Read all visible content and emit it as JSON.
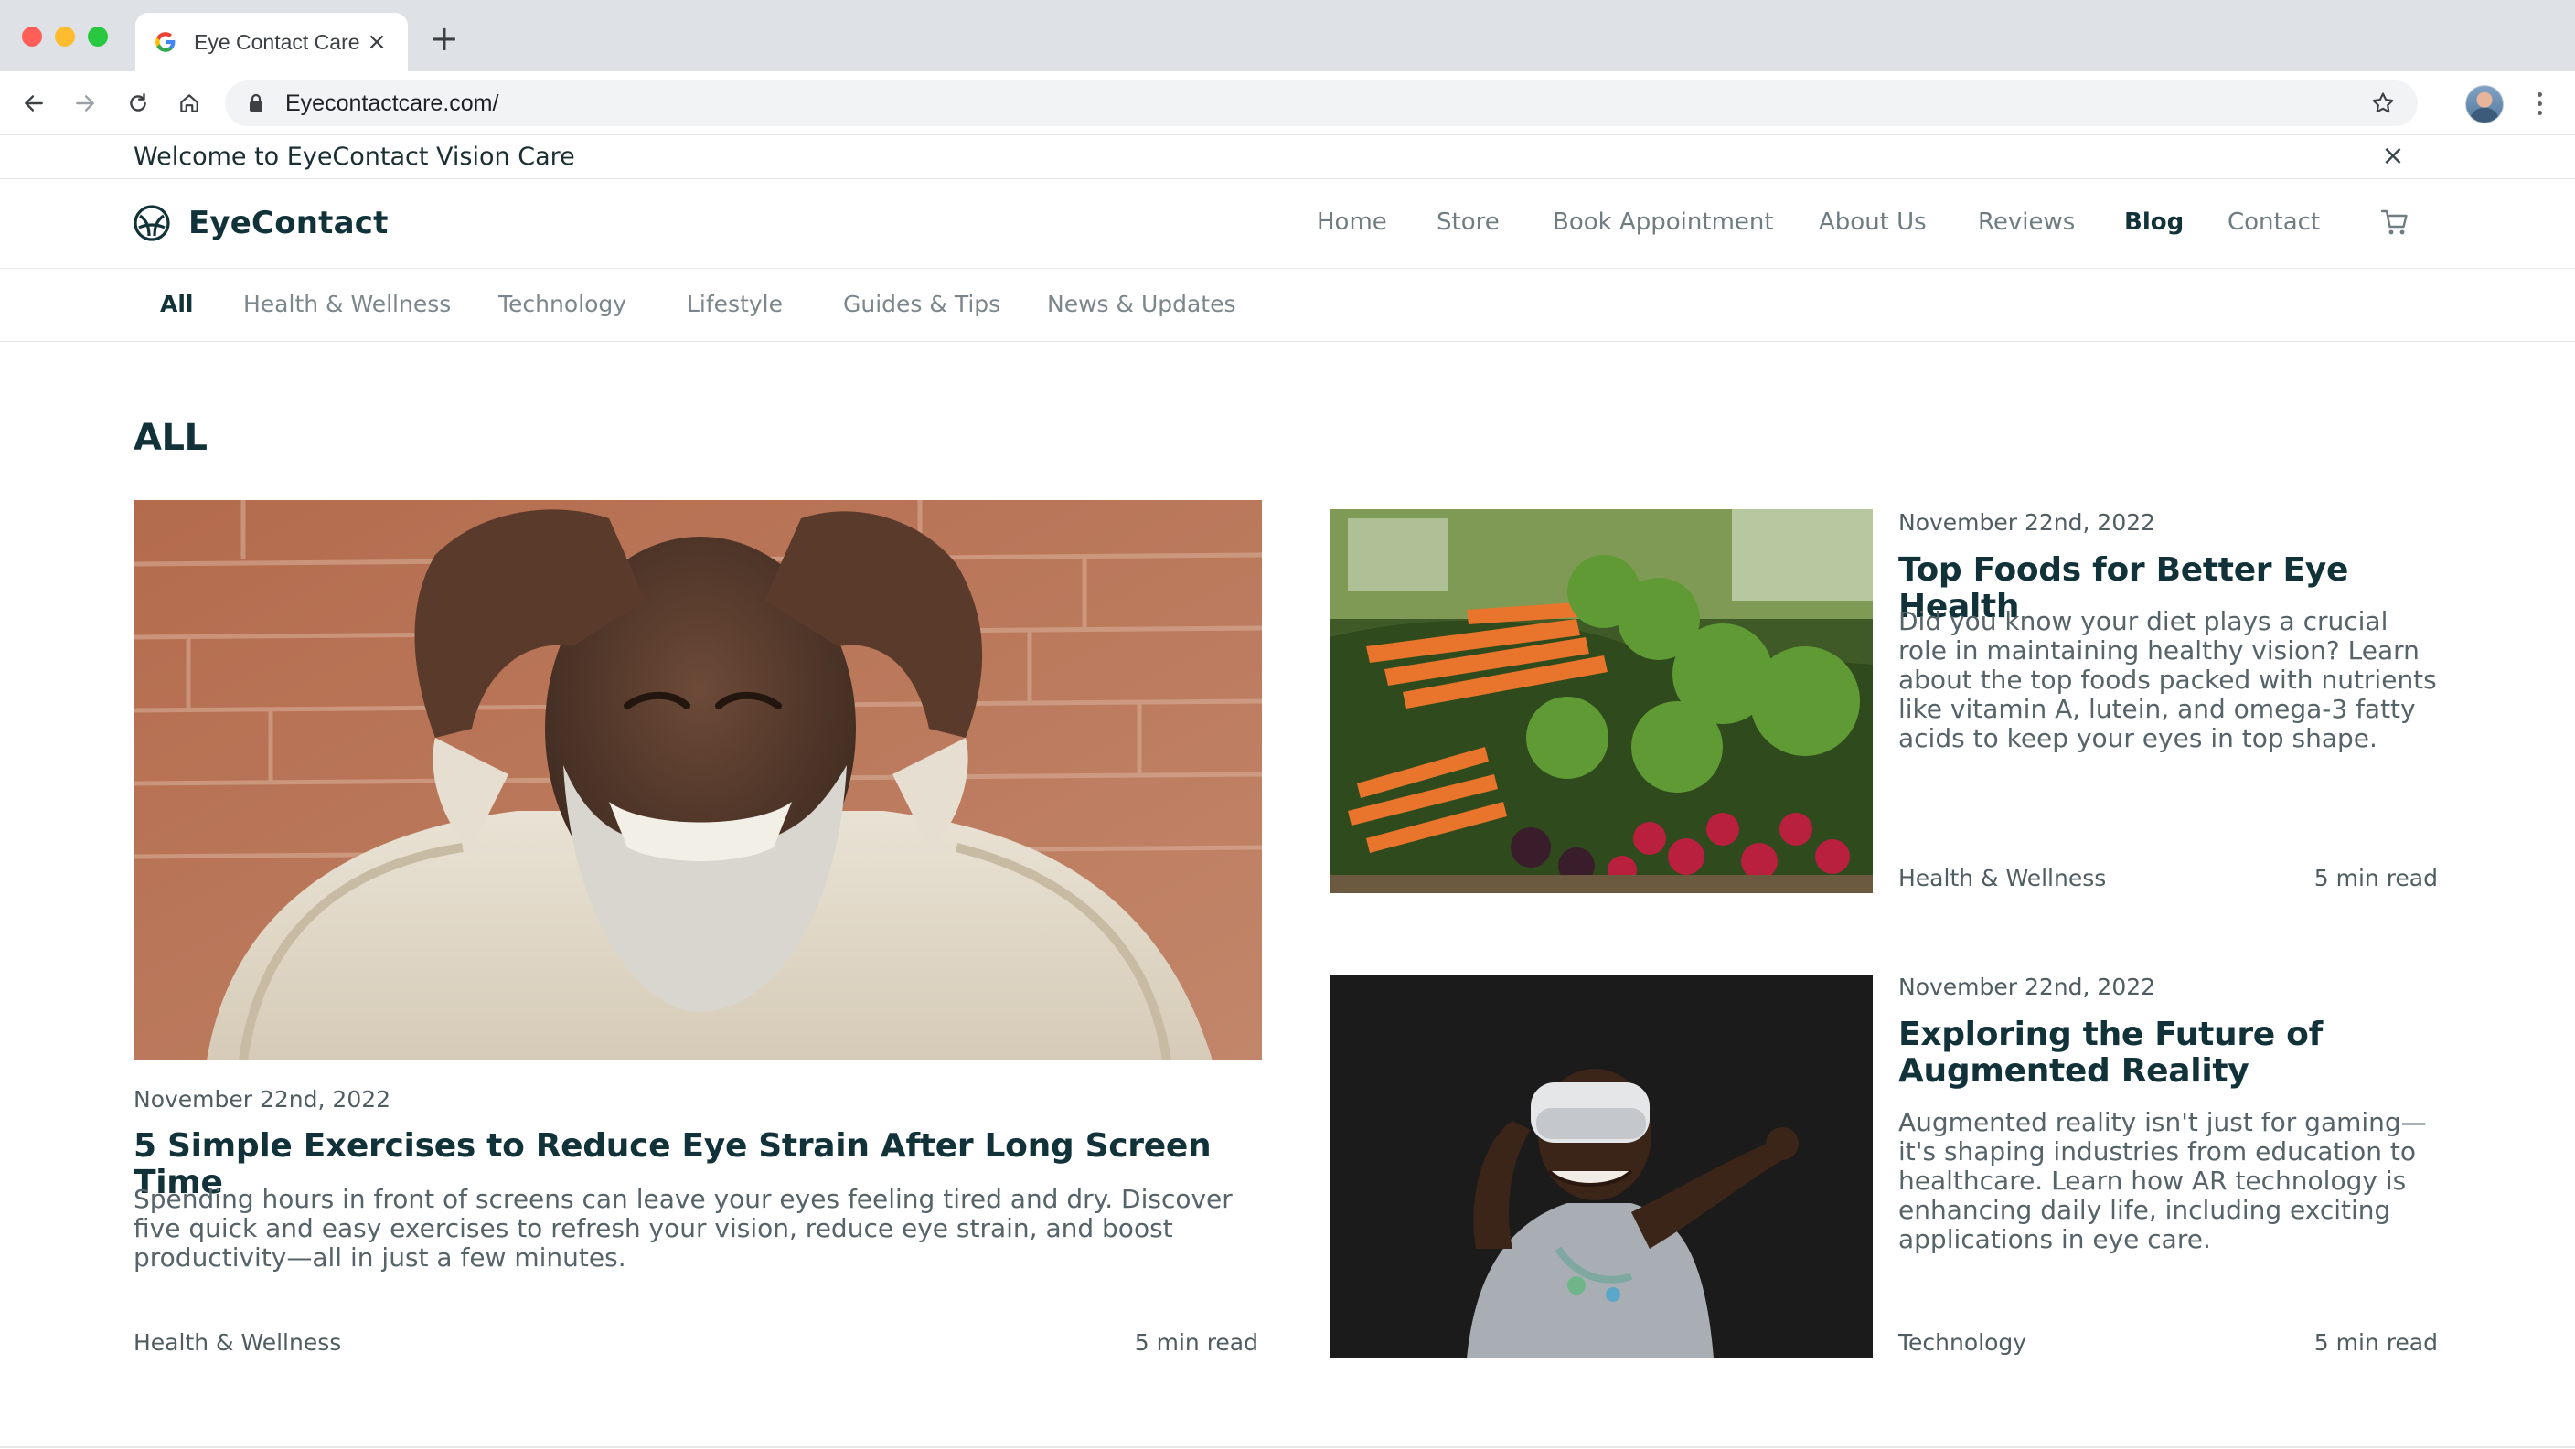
{
  "browser": {
    "tab_title": "Eye Contact Care",
    "url": "Eyecontactcare.com/",
    "new_tab_label": "+",
    "tab_close_label": "×"
  },
  "announcement": {
    "text": "Welcome to EyeContact Vision Care",
    "close_label": "×"
  },
  "header": {
    "brand": "EyeContact",
    "nav": [
      {
        "label": "Home"
      },
      {
        "label": "Store"
      },
      {
        "label": "Book Appointment"
      },
      {
        "label": "About Us"
      },
      {
        "label": "Reviews"
      },
      {
        "label": "Blog"
      },
      {
        "label": "Contact"
      }
    ],
    "active_nav": "Blog"
  },
  "categories": {
    "items": [
      {
        "label": "All"
      },
      {
        "label": "Health & Wellness"
      },
      {
        "label": "Technology"
      },
      {
        "label": "Lifestyle"
      },
      {
        "label": "Guides & Tips"
      },
      {
        "label": "News & Updates"
      }
    ],
    "active": "All"
  },
  "section_title": "ALL",
  "articles": [
    {
      "date": "November 22nd, 2022",
      "title": "5 Simple Exercises to Reduce Eye Strain After Long Screen Time",
      "excerpt": "Spending hours in front of screens can leave your eyes feeling tired and dry. Discover five quick and easy exercises to refresh your vision, reduce eye strain, and boost productivity—all in just a few minutes.",
      "category": "Health & Wellness",
      "read_time": "5 min read"
    },
    {
      "date": "November 22nd, 2022",
      "title": "Top Foods for Better Eye Health",
      "excerpt": "Did you know your diet plays a crucial role in maintaining healthy vision? Learn about the top foods packed with nutrients like vitamin A, lutein, and omega-3 fatty acids to keep your eyes in top shape.",
      "category": "Health & Wellness",
      "read_time": "5 min read"
    },
    {
      "date": "November 22nd, 2022",
      "title": "Exploring the Future of Augmented Reality",
      "excerpt": "Augmented reality isn't just for gaming—it's shaping industries from education to healthcare. Learn how AR technology is enhancing daily life, including exciting applications in eye care.",
      "category": "Technology",
      "read_time": "5 min read"
    }
  ],
  "icons": {
    "favicon": "google-g-icon",
    "back": "arrow-left-icon",
    "forward": "arrow-right-icon",
    "reload": "reload-icon",
    "home": "home-icon",
    "lock": "lock-icon",
    "bookmark": "star-icon",
    "menu": "kebab-menu-icon",
    "cart": "shopping-cart-icon",
    "logo": "eye-logo-icon"
  },
  "colors": {
    "text_primary": "#12323a",
    "text_muted": "#6f7d82",
    "border": "#e5e7e8",
    "chrome_bg": "#dee1e6"
  }
}
